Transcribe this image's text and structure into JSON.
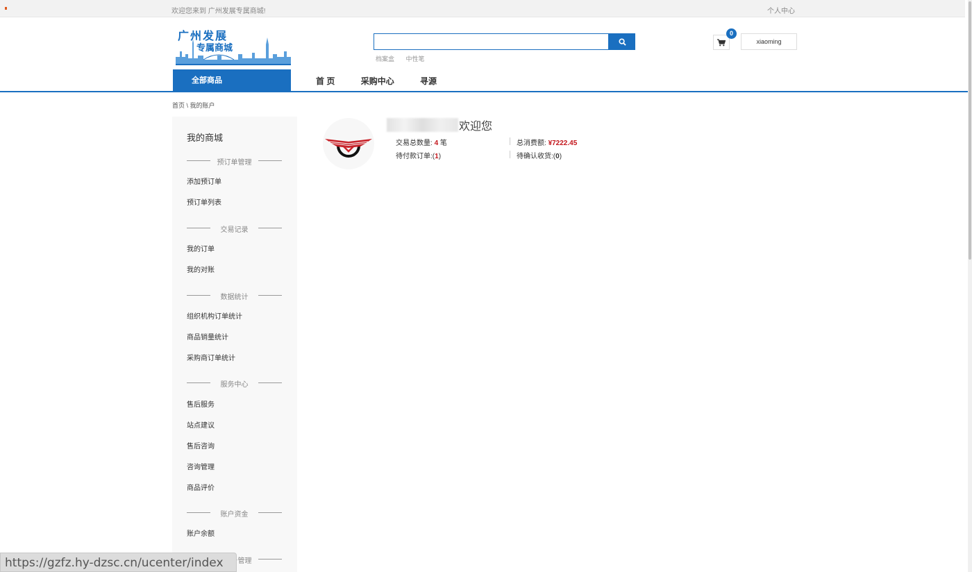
{
  "topbar": {
    "welcome": "欢迎您来到 广州发展专属商城!",
    "personal_center": "个人中心"
  },
  "logo": {
    "line1": "广州发展",
    "line2": "专属商城"
  },
  "search": {
    "value": "",
    "placeholder": "",
    "hot_words": [
      "档案盒",
      "中性笔"
    ]
  },
  "cart": {
    "count": "0"
  },
  "user": {
    "name": "xiaoming"
  },
  "nav": {
    "all_goods": "全部商品",
    "links": [
      "首 页",
      "采购中心",
      "寻源"
    ]
  },
  "breadcrumb": "首页 \\ 我的账户",
  "sidebar": {
    "title": "我的商城",
    "sections": [
      {
        "heading": "预订单管理",
        "items": [
          "添加预订单",
          "预订单列表"
        ]
      },
      {
        "heading": "交易记录",
        "items": [
          "我的订单",
          "我的对账"
        ]
      },
      {
        "heading": "数据统计",
        "items": [
          "组织机构订单统计",
          "商品销量统计",
          "采购商订单统计"
        ]
      },
      {
        "heading": "服务中心",
        "items": [
          "售后服务",
          "站点建议",
          "售后咨询",
          "咨询管理",
          "商品评价"
        ]
      },
      {
        "heading": "账户资金",
        "items": [
          "账户余额"
        ]
      },
      {
        "heading": "子账号管理",
        "items": []
      }
    ]
  },
  "profile": {
    "welcome": "欢迎您",
    "trade_count_label": "交易总数量:",
    "trade_count": "4",
    "trade_count_unit": "笔",
    "total_spent_label": "总消费额:",
    "total_spent": "¥7222.45",
    "pending_pay_label": "待付款订单:",
    "pending_pay_open": "(",
    "pending_pay": "1",
    "pending_pay_close": ")",
    "pending_receive_label": "待确认收货:",
    "pending_receive_open": "(",
    "pending_receive": "0",
    "pending_receive_close": ")"
  },
  "status_url": "https://gzfz.hy-dzsc.cn/ucenter/index",
  "colors": {
    "brand_blue": "#1a6fc0",
    "price_red": "#c3161c"
  }
}
